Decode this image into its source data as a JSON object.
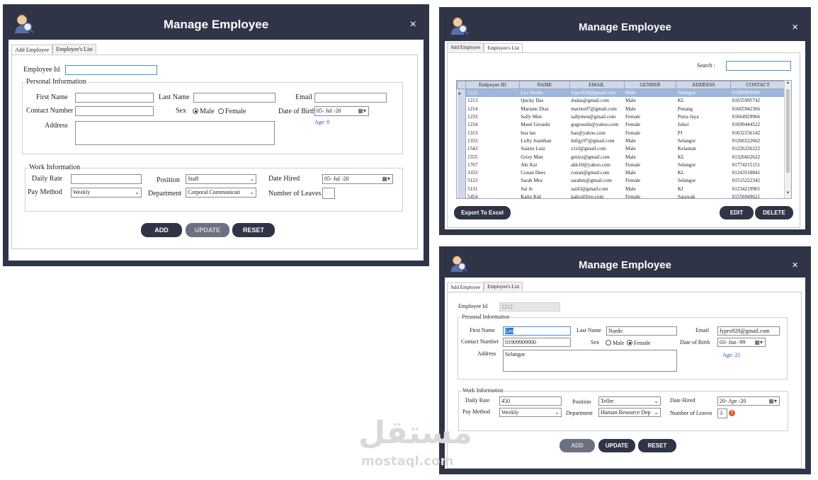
{
  "colors": {
    "titlebar": "#2f3547",
    "button": "#2f3547",
    "age_text": "#2f55c8",
    "selected_row": "#9db7dc"
  },
  "icons": {
    "logo": "user-avatar-icon",
    "close": "close-icon",
    "calendar": "calendar-icon",
    "warning": "warning-icon"
  },
  "form_empty": {
    "title": "Manage Employee",
    "close": "×",
    "tabs": [
      "Add Employee",
      "Employee's List"
    ],
    "employee_id_label": "Employee Id",
    "employee_id_value": "",
    "personal_title": "Personal Information",
    "first_name_label": "First Name",
    "first_name_value": "",
    "last_name_label": "Last Name",
    "last_name_value": "",
    "email_label": "Email",
    "email_value": "",
    "contact_label": "Contact Number",
    "contact_value": "",
    "sex_label": "Sex",
    "male_label": "Male",
    "female_label": "Female",
    "sex_selected": "Male",
    "dob_label": "Date of Birth",
    "dob_value": "05- Jul -20",
    "age_text": "Age: 0",
    "address_label": "Address",
    "address_value": "",
    "work_title": "Work Information",
    "daily_rate_label": "Daily Rate",
    "daily_rate_value": "",
    "position_label": "Position",
    "position_value": "Staff",
    "date_hired_label": "Date Hired",
    "date_hired_value": "05- Jul -20",
    "pay_method_label": "Pay Method",
    "pay_method_value": "Weekly",
    "department_label": "Department",
    "department_value": "Corporal Communicati",
    "leaves_label": "Number of Leaves",
    "leaves_value": "",
    "buttons": {
      "add": "ADD",
      "update": "UPDATE",
      "reset": "RESET"
    }
  },
  "list_window": {
    "title": "Manage Employee",
    "close": "×",
    "tabs": [
      "Add Employee",
      "Employee's List"
    ],
    "search_label": "Search :",
    "search_value": "",
    "columns": [
      "Emlpoyee ID",
      "NAME",
      "EMAIL",
      "GENDER",
      "ADDRESS",
      "CONTACT"
    ],
    "selected_indicator": "▸",
    "rows": [
      [
        "1212",
        "Leo Nardo",
        "fypro920@gmail.com",
        "Male",
        "Selangor",
        "01909909900"
      ],
      [
        "1213",
        "Qucky Das",
        "dodas@gmail.com",
        "Male",
        "KL",
        "01655995742"
      ],
      [
        "1214",
        "Mariano Diaz",
        "marino07@gmail.com",
        "Male",
        "Penang",
        "01665942366"
      ],
      [
        "1233",
        "Sally Men",
        "sallymen@gmail.com",
        "Female",
        "Putra Jaya",
        "01664929966"
      ],
      [
        "1234",
        "Masti Groushi",
        "gogruoshi@yahoo.com",
        "Female",
        "Johor",
        "01699444522"
      ],
      [
        "1313",
        "boa lan",
        "bao@yahoo.com",
        "Female",
        "PJ",
        "01632156142"
      ],
      [
        "1333",
        "Lufty Joanthan",
        "lutfgy97@gmail.com",
        "Male",
        "Selangor",
        "01266522662"
      ],
      [
        "1543",
        "Suarez Luiz",
        "z1zf@gmail.com",
        "Male",
        "Kelantan",
        "01226226222"
      ],
      [
        "1555",
        "Grizy Man",
        "greizz@gmail.com",
        "Male",
        "KL",
        "01326662622"
      ],
      [
        "1767",
        "Aki Kai",
        "akk10@yahoo.com",
        "Female",
        "Selangor",
        "01774215151"
      ],
      [
        "3333",
        "Conan Dees",
        "conan@gmail.com",
        "Male",
        "KL",
        "01243518841"
      ],
      [
        "5123",
        "Sarah Mez",
        "sarahm@gmail.com",
        "Female",
        "Selangor",
        "01515222342"
      ],
      [
        "5131",
        "Sai Je",
        "sai43@gmail.com",
        "Male",
        "KJ",
        "01234219901"
      ],
      [
        "5454",
        "Kaito Kid",
        "kaito@live.com",
        "Female",
        "Sarawak",
        "01556949621"
      ]
    ],
    "buttons": {
      "export": "Export To Excel",
      "edit": "EDIT",
      "delete": "DELETE"
    }
  },
  "form_filled": {
    "title": "Manage Employee",
    "close": "×",
    "tabs": [
      "Add Employee",
      "Employee's List"
    ],
    "employee_id_label": "Employee Id",
    "employee_id_value": "1212",
    "personal_title": "Personal Information",
    "first_name_label": "First Name",
    "first_name_value": "Leo",
    "last_name_label": "Last Name",
    "last_name_value": "Nardo",
    "email_label": "Email",
    "email_value": "fypro920@gmail.com",
    "contact_label": "Contact Number",
    "contact_value": "01909909900",
    "sex_label": "Sex",
    "male_label": "Male",
    "female_label": "Female",
    "sex_selected": "Female",
    "dob_label": "Date of Birth",
    "dob_value": "03- Jun -99",
    "age_text": "Age: 21",
    "address_label": "Address",
    "address_value": "Selangor",
    "work_title": "Work Information",
    "daily_rate_label": "Daily Rate",
    "daily_rate_value": "450",
    "position_label": "Position",
    "position_value": "Teller",
    "date_hired_label": "Date Hired",
    "date_hired_value": "20- Apr -20",
    "pay_method_label": "Pay Method",
    "pay_method_value": "Weekly",
    "department_label": "Department",
    "department_value": "Human Resource Dep",
    "leaves_label": "Number of Leaves",
    "leaves_value": "3",
    "buttons": {
      "add": "ADD",
      "update": "UPDATE",
      "reset": "RESET"
    }
  },
  "watermark": {
    "arabic": "مستقل",
    "latin": "mostaql.com"
  }
}
